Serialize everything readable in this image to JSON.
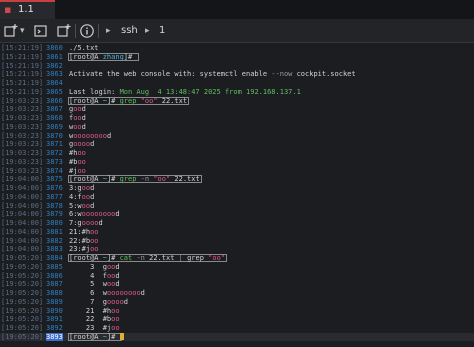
{
  "tab": {
    "title": "1.1",
    "close_icon": "close-icon"
  },
  "toolbar": {
    "icons": [
      "new-tab-icon",
      "new-terminal-icon",
      "new-window-icon",
      "info-icon"
    ],
    "crumbs": [
      "ssh",
      "1"
    ]
  },
  "colors": {
    "accent": "#c94040",
    "timestamp": "#5b6e88",
    "line_number": "#2d7fbf",
    "host": "#5fbf5f",
    "match": "#e05b8a",
    "cursor": "#e0b030"
  },
  "lines": [
    {
      "ts": "[15:21:19]",
      "n": "3860",
      "text": "./5.txt"
    },
    {
      "ts": "[15:21:19]",
      "n": "3861",
      "prompt": true,
      "text": "[root@A zhang]# "
    },
    {
      "ts": "[15:21:19]",
      "n": "3862",
      "text": ""
    },
    {
      "ts": "[15:21:19]",
      "n": "3863",
      "text": "Activate the web console with: systemctl enable --now cockpit.socket"
    },
    {
      "ts": "[15:21:19]",
      "n": "3864",
      "text": ""
    },
    {
      "ts": "[15:21:19]",
      "n": "3865",
      "login": true,
      "text_a": "Last login: ",
      "text_b": "Mon Aug  4 13:48:47 2025 from ",
      "text_c": "192.168.137.1"
    },
    {
      "ts": "[19:03:23]",
      "n": "3866",
      "prompt": true,
      "text": "[root@A ~]# grep \"oo\" 22.txt"
    },
    {
      "ts": "[19:03:23]",
      "n": "3867",
      "g": [
        "g",
        "oo",
        "d"
      ]
    },
    {
      "ts": "[19:03:23]",
      "n": "3868",
      "g": [
        "f",
        "oo",
        "d"
      ]
    },
    {
      "ts": "[19:03:23]",
      "n": "3869",
      "g": [
        "w",
        "oo",
        "d"
      ]
    },
    {
      "ts": "[19:03:23]",
      "n": "3870",
      "g": [
        "w",
        "oooooooo",
        "d"
      ]
    },
    {
      "ts": "[19:03:23]",
      "n": "3871",
      "g": [
        "g",
        "oooo",
        "d"
      ]
    },
    {
      "ts": "[19:03:23]",
      "n": "3872",
      "g": [
        "#h",
        "oo",
        ""
      ]
    },
    {
      "ts": "[19:03:23]",
      "n": "3873",
      "g": [
        "#b",
        "oo",
        ""
      ]
    },
    {
      "ts": "[19:03:23]",
      "n": "3874",
      "g": [
        "#j",
        "oo",
        ""
      ]
    },
    {
      "ts": "[19:04:00]",
      "n": "3875",
      "prompt": true,
      "text": "[root@A ~]# grep -n \"oo\" 22.txt"
    },
    {
      "ts": "[19:04:00]",
      "n": "3876",
      "g": [
        "3:g",
        "oo",
        "d"
      ]
    },
    {
      "ts": "[19:04:00]",
      "n": "3877",
      "g": [
        "4:f",
        "oo",
        "d"
      ]
    },
    {
      "ts": "[19:04:00]",
      "n": "3878",
      "g": [
        "5:w",
        "oo",
        "d"
      ]
    },
    {
      "ts": "[19:04:00]",
      "n": "3879",
      "g": [
        "6:w",
        "oooooooo",
        "d"
      ]
    },
    {
      "ts": "[19:04:00]",
      "n": "3880",
      "g": [
        "7:g",
        "oooo",
        "d"
      ]
    },
    {
      "ts": "[19:04:00]",
      "n": "3881",
      "g": [
        "21:#h",
        "oo",
        ""
      ]
    },
    {
      "ts": "[19:04:00]",
      "n": "3882",
      "g": [
        "22:#b",
        "oo",
        ""
      ]
    },
    {
      "ts": "[19:04:00]",
      "n": "3883",
      "g": [
        "23:#j",
        "oo",
        ""
      ]
    },
    {
      "ts": "[19:05:20]",
      "n": "3884",
      "prompt": true,
      "text": "[root@A ~]# cat -n 22.txt | grep \"oo\""
    },
    {
      "ts": "[19:05:20]",
      "n": "3885",
      "g": [
        "     3  g",
        "oo",
        "d"
      ]
    },
    {
      "ts": "[19:05:20]",
      "n": "3886",
      "g": [
        "     4  f",
        "oo",
        "d"
      ]
    },
    {
      "ts": "[19:05:20]",
      "n": "3887",
      "g": [
        "     5  w",
        "oo",
        "d"
      ]
    },
    {
      "ts": "[19:05:20]",
      "n": "3888",
      "g": [
        "     6  w",
        "oooooooo",
        "d"
      ]
    },
    {
      "ts": "[19:05:20]",
      "n": "3889",
      "g": [
        "     7  g",
        "oooo",
        "d"
      ]
    },
    {
      "ts": "[19:05:20]",
      "n": "3890",
      "g": [
        "    21  #h",
        "oo",
        ""
      ]
    },
    {
      "ts": "[19:05:20]",
      "n": "3891",
      "g": [
        "    22  #b",
        "oo",
        ""
      ]
    },
    {
      "ts": "[19:05:20]",
      "n": "3892",
      "g": [
        "    23  #j",
        "oo",
        ""
      ]
    },
    {
      "ts": "[19:05:20]",
      "n": "3893",
      "prompt": true,
      "cursor": true,
      "active": true,
      "text": "[root@A ~]# "
    }
  ]
}
